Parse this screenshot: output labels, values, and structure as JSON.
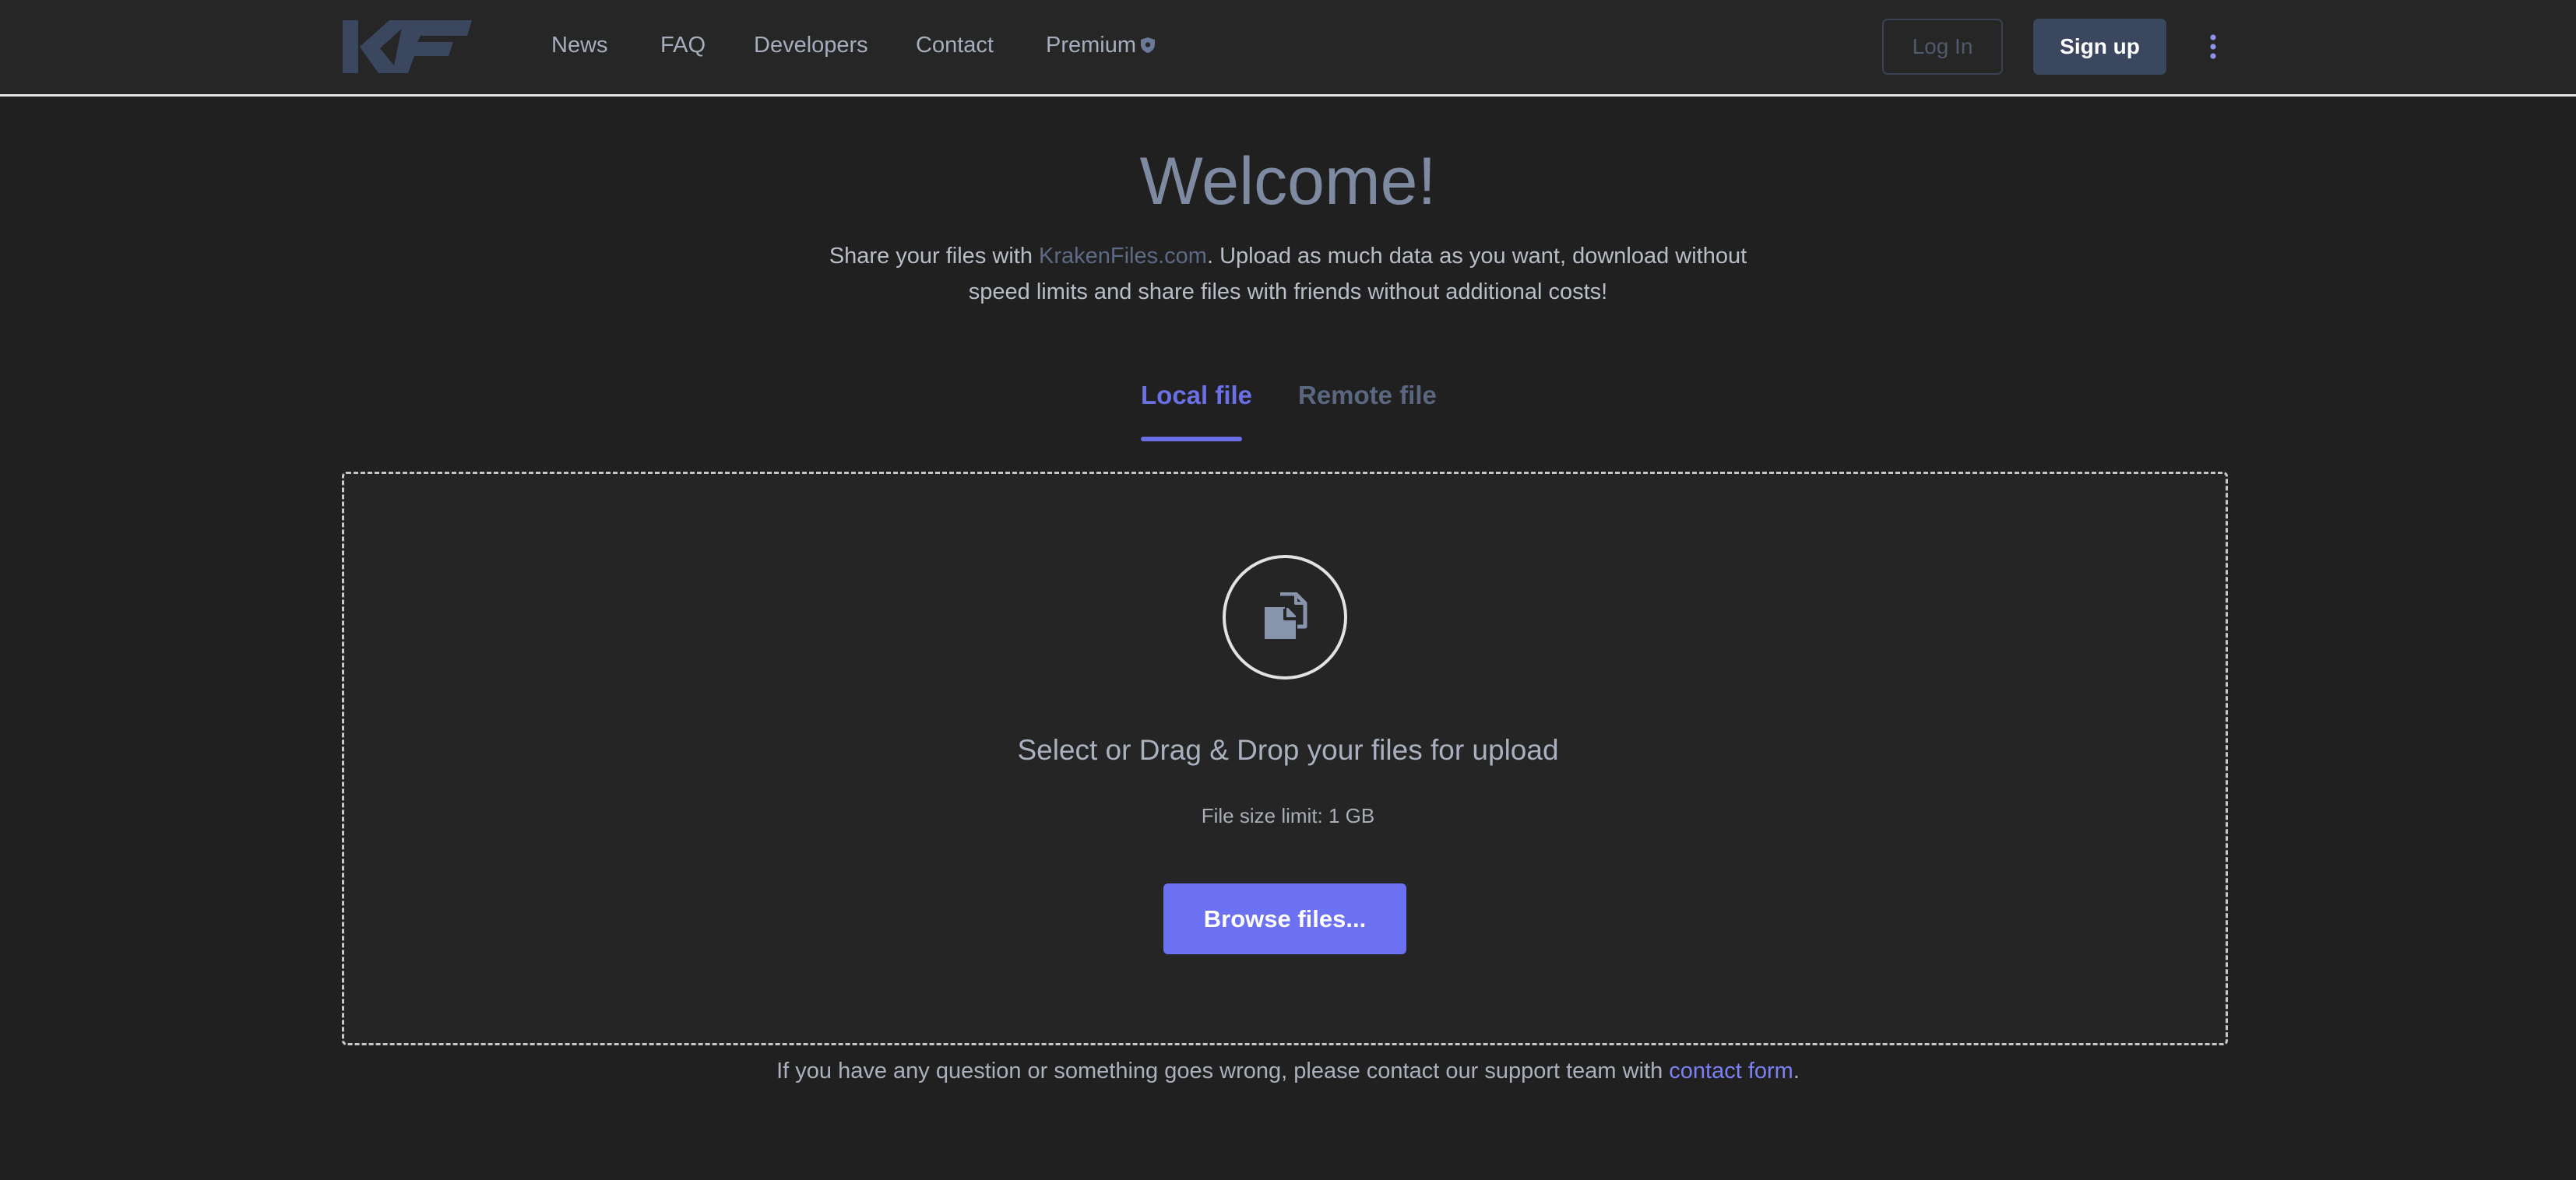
{
  "colors": {
    "background": "#202020",
    "navbar": "#262626",
    "accent": "#6c71f1",
    "heading": "#7e8aa1",
    "muted_link": "#5c6a86",
    "signup_bg": "#3b475e"
  },
  "header": {
    "logo_text": "KF",
    "logo_icon": "krakenfiles-logo",
    "nav": [
      {
        "label": "News"
      },
      {
        "label": "FAQ"
      },
      {
        "label": "Developers"
      },
      {
        "label": "Contact"
      },
      {
        "label": "Premium",
        "icon": "shield-icon"
      }
    ],
    "login_label": "Log In",
    "signup_label": "Sign up",
    "menu_icon": "kebab-menu-icon"
  },
  "hero": {
    "title": "Welcome!",
    "intro_before": "Share your files with ",
    "intro_link": "KrakenFiles.com",
    "intro_after": ". Upload as much data as you want, download without speed limits and share files with friends without additional costs!"
  },
  "tabs": [
    {
      "label": "Local file",
      "active": true
    },
    {
      "label": "Remote file",
      "active": false
    }
  ],
  "upload": {
    "icon": "files-copy-icon",
    "instruction": "Select or Drag & Drop your files for upload",
    "limit": "File size limit: 1 GB",
    "browse_label": "Browse files..."
  },
  "support": {
    "before": "If you have any question or something goes wrong, please contact our support team with ",
    "link": "contact form",
    "after": "."
  }
}
